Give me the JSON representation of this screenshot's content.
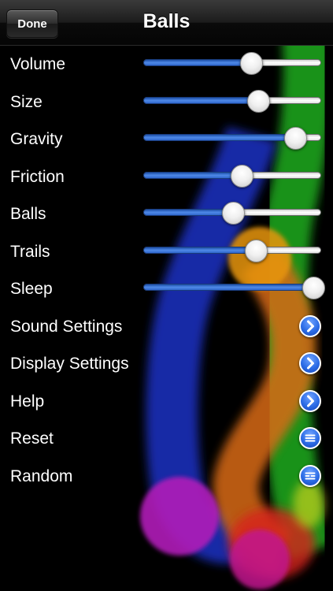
{
  "nav": {
    "title": "Balls",
    "done_label": "Done"
  },
  "sliders": [
    {
      "label": "Volume",
      "value": 0.6
    },
    {
      "label": "Size",
      "value": 0.64
    },
    {
      "label": "Gravity",
      "value": 0.85
    },
    {
      "label": "Friction",
      "value": 0.55
    },
    {
      "label": "Balls",
      "value": 0.5
    },
    {
      "label": "Trails",
      "value": 0.63
    },
    {
      "label": "Sleep",
      "value": 0.95
    }
  ],
  "links": [
    {
      "label": "Sound Settings",
      "icon": "chevron-right-icon"
    },
    {
      "label": "Display Settings",
      "icon": "chevron-right-icon"
    },
    {
      "label": "Help",
      "icon": "chevron-right-icon"
    },
    {
      "label": "Reset",
      "icon": "list-icon"
    },
    {
      "label": "Random",
      "icon": "list-icon"
    }
  ]
}
